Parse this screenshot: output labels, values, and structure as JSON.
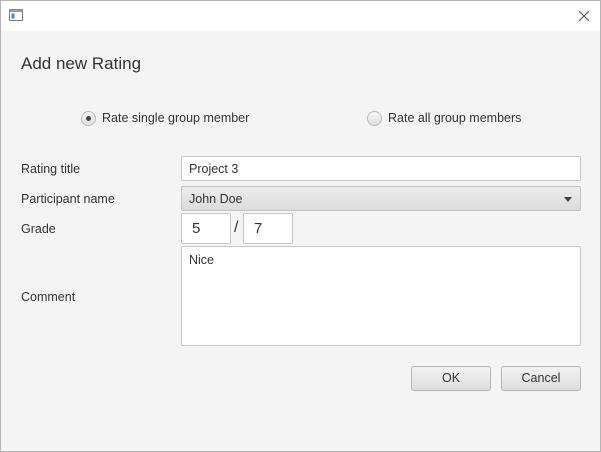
{
  "window": {
    "close_glyph": "✕"
  },
  "dialog": {
    "title": "Add new Rating"
  },
  "mode": {
    "single_label": "Rate single group member",
    "all_label": "Rate all group members",
    "selected": "single"
  },
  "form": {
    "rating_title_label": "Rating title",
    "rating_title_value": "Project 3",
    "participant_label": "Participant name",
    "participant_value": "John Doe",
    "grade_label": "Grade",
    "grade_value": "5",
    "grade_separator": "/",
    "grade_max": "7",
    "comment_label": "Comment",
    "comment_value": "Nice"
  },
  "buttons": {
    "ok_label": "OK",
    "cancel_label": "Cancel"
  },
  "icons": {
    "app": "window-icon",
    "close": "close-icon",
    "dropdown": "chevron-down-icon"
  }
}
